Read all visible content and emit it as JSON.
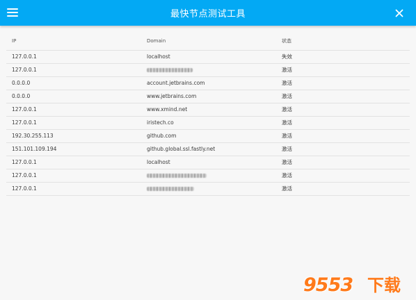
{
  "app": {
    "title": "最快节点测试工具"
  },
  "colors": {
    "appbar": "#03a9f4",
    "background": "#f7f7f7",
    "watermark": "#ff7a1a"
  },
  "icons": {
    "menu": "hamburger-menu-icon",
    "close": "close-icon"
  },
  "table": {
    "headers": {
      "ip": "IP",
      "domain": "Domain",
      "status": "状态"
    },
    "rows": [
      {
        "ip": "127.0.0.1",
        "domain": "localhost",
        "status": "失效"
      },
      {
        "ip": "127.0.0.1",
        "domain": "",
        "status": "激活"
      },
      {
        "ip": "0.0.0.0",
        "domain": "account.jetbrains.com",
        "status": "激活"
      },
      {
        "ip": "0.0.0.0",
        "domain": "www.jetbrains.com",
        "status": "激活"
      },
      {
        "ip": "127.0.0.1",
        "domain": "www.xmind.net",
        "status": "激活"
      },
      {
        "ip": "127.0.0.1",
        "domain": "iristech.co",
        "status": "激活"
      },
      {
        "ip": "192.30.255.113",
        "domain": "github.com",
        "status": "激活"
      },
      {
        "ip": "151.101.109.194",
        "domain": "github.global.ssl.fastly.net",
        "status": "激活"
      },
      {
        "ip": "127.0.0.1",
        "domain": "localhost",
        "status": "激活"
      },
      {
        "ip": "127.0.0.1",
        "domain": "",
        "status": "激活"
      },
      {
        "ip": "127.0.0.1",
        "domain": "",
        "status": "激活"
      }
    ]
  },
  "watermark": {
    "number": "9553",
    "text": "下载"
  }
}
